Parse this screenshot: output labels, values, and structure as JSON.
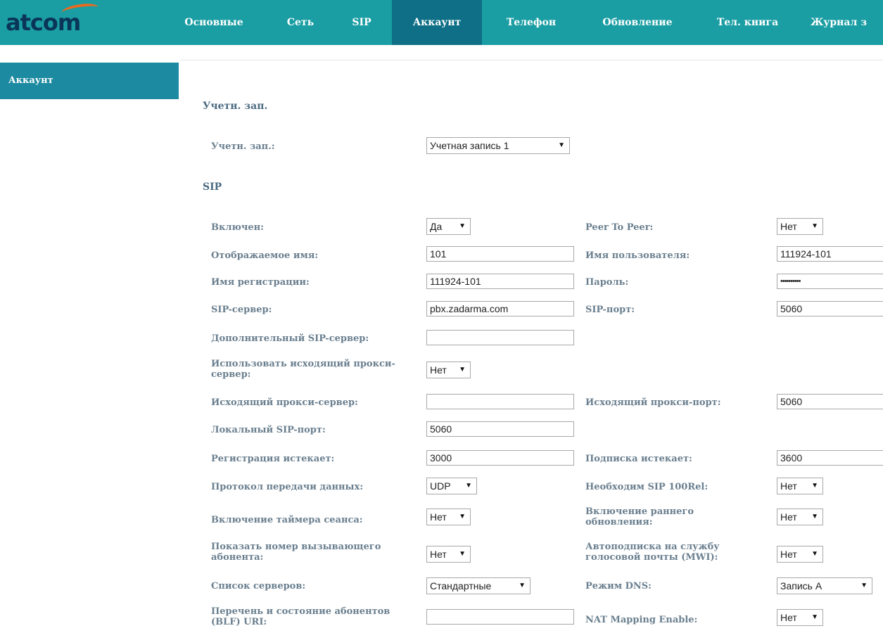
{
  "brand": {
    "logo_text": "atcom"
  },
  "nav": [
    {
      "label": "Основные"
    },
    {
      "label": "Сеть"
    },
    {
      "label": "SIP"
    },
    {
      "label": "Аккаунт"
    },
    {
      "label": "Телефон"
    },
    {
      "label": "Обновление"
    },
    {
      "label": "Тел. книга"
    },
    {
      "label": "Журнал з"
    }
  ],
  "sidebar": {
    "item": "Аккаунт"
  },
  "account_section": {
    "title": "Учетн. зап.",
    "label": "Учетн. зап.:",
    "value": "Учетная запись 1"
  },
  "sip_section": {
    "title": "SIP"
  },
  "fields": {
    "enabled": {
      "label": "Включен:",
      "value": "Да"
    },
    "peer_to_peer": {
      "label": "Peer To Peer:",
      "value": "Нет"
    },
    "display_name": {
      "label": "Отображаемое имя:",
      "value": "101"
    },
    "user_name": {
      "label": "Имя пользователя:",
      "value": "111924-101"
    },
    "register_name": {
      "label": "Имя регистрации:",
      "value": "111924-101"
    },
    "password": {
      "label": "Пароль:",
      "value": "••••••••••"
    },
    "sip_server": {
      "label": "SIP-сервер:",
      "value": "pbx.zadarma.com"
    },
    "sip_port": {
      "label": "SIP-порт:",
      "value": "5060"
    },
    "backup_sip_server": {
      "label": "Дополнительный SIP-сервер:",
      "value": ""
    },
    "use_outbound_proxy": {
      "label": "Использовать исходящий прокси-сервер:",
      "value": "Нет"
    },
    "outbound_proxy": {
      "label": "Исходящий прокси-сервер:",
      "value": ""
    },
    "outbound_proxy_port": {
      "label": "Исходящий прокси-порт:",
      "value": "5060"
    },
    "local_sip_port": {
      "label": "Локальный SIP-порт:",
      "value": "5060"
    },
    "register_expire": {
      "label": "Регистрация истекает:",
      "value": "3000"
    },
    "subscribe_expire": {
      "label": "Подписка истекает:",
      "value": "3600"
    },
    "transport": {
      "label": "Протокол передачи данных:",
      "value": "UDP"
    },
    "sip_100rel": {
      "label": "Необходим SIP 100Rel:",
      "value": "Нет"
    },
    "session_timer": {
      "label": "Включение таймера сеанса:",
      "value": "Нет"
    },
    "early_update": {
      "label": "Включение раннего обновления:",
      "value": "Нет"
    },
    "caller_id": {
      "label": "Показать номер вызывающего абонента:",
      "value": "Нет"
    },
    "mwi": {
      "label": "Автоподписка на службу голосовой почты (MWI):",
      "value": "Нет"
    },
    "server_list": {
      "label": "Список серверов:",
      "value": "Стандартные"
    },
    "dns_mode": {
      "label": "Режим DNS:",
      "value": "Запись А"
    },
    "blf_uri": {
      "label": "Перечень и состояние абонентов (BLF) URI:",
      "value": ""
    },
    "nat_mapping": {
      "label": "NAT Mapping Enable:",
      "value": "Нет"
    }
  },
  "colors": {
    "topbar": "#1a9ea3",
    "nav_active": "#0e6f86",
    "sidebar": "#1c8aa0",
    "label": "#6a7f8f",
    "logo_text": "#0b3557",
    "logo_accent": "#e86a1f"
  }
}
